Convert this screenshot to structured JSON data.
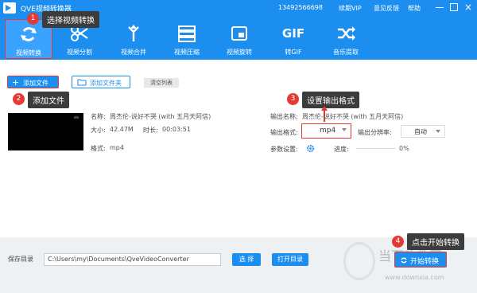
{
  "titlebar": {
    "title": "QVE视频转换器",
    "phone": "13492566698",
    "vip": "续期VIP",
    "feedback": "意见反馈",
    "help": "帮助",
    "close": "×"
  },
  "toolbar": {
    "items": [
      {
        "label": "视频转换",
        "icon": "refresh-icon"
      },
      {
        "label": "视频分割",
        "icon": "scissors-icon"
      },
      {
        "label": "视频合并",
        "icon": "merge-icon"
      },
      {
        "label": "视频压缩",
        "icon": "compress-icon"
      },
      {
        "label": "视频旋转",
        "icon": "rotate-icon"
      },
      {
        "label": "转GIF",
        "icon": "gif-icon",
        "icon_text": "GIF"
      },
      {
        "label": "音乐提取",
        "icon": "shuffle-icon"
      }
    ]
  },
  "annotations": [
    {
      "num": "1",
      "text": "选择视频转换"
    },
    {
      "num": "2",
      "text": "添加文件"
    },
    {
      "num": "3",
      "text": "设置输出格式"
    },
    {
      "num": "4",
      "text": "点击开始转换"
    }
  ],
  "actions": {
    "add_file": "添加文件",
    "add_folder": "添加文件夹",
    "clear_list": "清空列表"
  },
  "file": {
    "name_label": "名称:",
    "name_value": "周杰伦-说好不哭 (with 五月天阿信)",
    "size_label": "大小:",
    "size_value": "42.47M",
    "duration_label": "时长:",
    "duration_value": "00:03:51",
    "format_label": "格式:",
    "format_value": "mp4"
  },
  "output": {
    "name_label": "输出名称:",
    "name_value": "周杰伦-说好不哭 (with 五月天阿信)",
    "format_label": "输出格式:",
    "format_value": "mp4",
    "resolution_label": "输出分辨率:",
    "resolution_value": "自动",
    "params_label": "参数设置:",
    "progress_label": "进度:",
    "progress_value": "0%",
    "progress": 0
  },
  "footer": {
    "save_dir_label": "保存目录",
    "save_dir_value": "C:\\Users\\my\\Documents\\QveVideoConverter",
    "select_button": "选 择",
    "open_dir_button": "打开目录",
    "start_button": "开始转换"
  },
  "watermark": {
    "brand": "当下软件园",
    "url": "www.downxia.com"
  },
  "colors": {
    "accent": "#1b8ef0",
    "annotation": "#e53935",
    "tooltip": "#3c3c3c"
  }
}
